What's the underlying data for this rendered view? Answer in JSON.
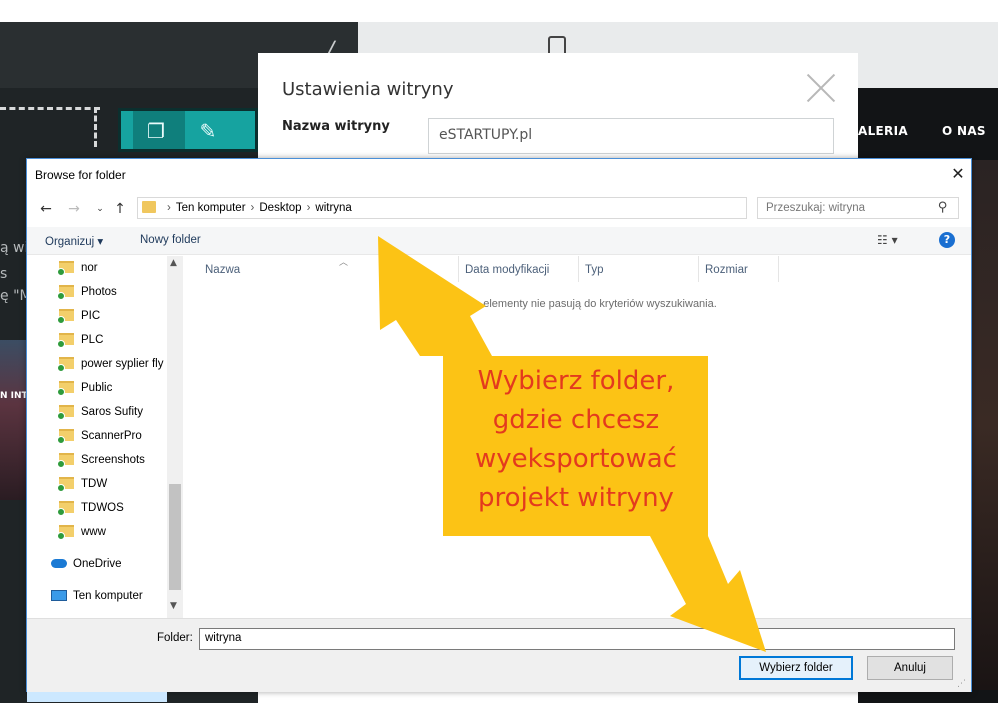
{
  "editor": {
    "nav_gallery": "ALERIA",
    "nav_about": "O NAS",
    "side_text_1": "ą wi",
    "side_text_2": "s",
    "side_text_3": "ę \"M",
    "photo_text": "N INTI"
  },
  "settings": {
    "title": "Ustawienia witryny",
    "site_name_label": "Nazwa witryny",
    "site_name_value": "eSTARTUPY.pl"
  },
  "dialog": {
    "title": "Browse for folder",
    "breadcrumbs": [
      "Ten komputer",
      "Desktop",
      "witryna"
    ],
    "search_placeholder": "Przeszukaj: witryna",
    "commands": {
      "organize": "Organizuj ▾",
      "new_folder": "Nowy folder"
    },
    "nav_items": [
      {
        "label": "nor"
      },
      {
        "label": "Photos"
      },
      {
        "label": "PIC"
      },
      {
        "label": "PLC"
      },
      {
        "label": "power syplier fly"
      },
      {
        "label": "Public"
      },
      {
        "label": "Saros Sufity"
      },
      {
        "label": "ScannerPro"
      },
      {
        "label": "Screenshots"
      },
      {
        "label": "TDW"
      },
      {
        "label": "TDWOS"
      },
      {
        "label": "www"
      }
    ],
    "nav_onedrive": "OneDrive",
    "nav_computer": "Ten komputer",
    "columns": [
      "Nazwa",
      "Data modyfikacji",
      "Typ",
      "Rozmiar"
    ],
    "empty_message": "Żadne elementy nie pasują do kryteriów wyszukiwania.",
    "folder_label": "Folder:",
    "folder_value": "witryna",
    "select_button": "Wybierz folder",
    "cancel_button": "Anuluj"
  },
  "annotation": {
    "lines": [
      "Wybierz folder,",
      "gdzie chcesz",
      "wyeksportować",
      "projekt witryny"
    ],
    "box_color": "#fcc315",
    "text_color": "#e33a1e"
  }
}
